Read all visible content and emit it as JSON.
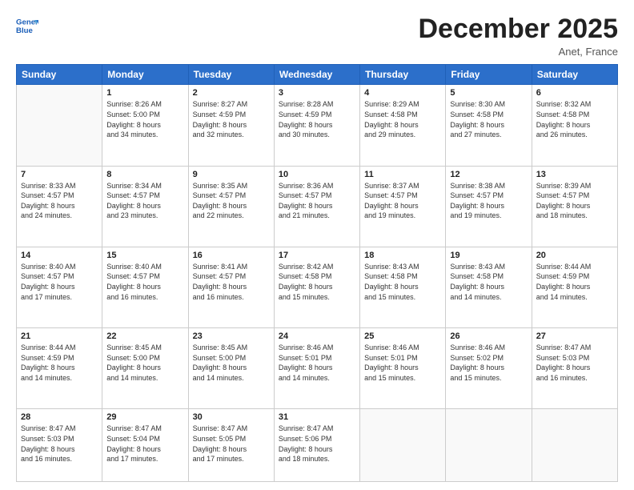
{
  "header": {
    "logo_line1": "General",
    "logo_line2": "Blue",
    "title": "December 2025",
    "location": "Anet, France"
  },
  "weekdays": [
    "Sunday",
    "Monday",
    "Tuesday",
    "Wednesday",
    "Thursday",
    "Friday",
    "Saturday"
  ],
  "weeks": [
    [
      {
        "day": "",
        "info": ""
      },
      {
        "day": "1",
        "info": "Sunrise: 8:26 AM\nSunset: 5:00 PM\nDaylight: 8 hours\nand 34 minutes."
      },
      {
        "day": "2",
        "info": "Sunrise: 8:27 AM\nSunset: 4:59 PM\nDaylight: 8 hours\nand 32 minutes."
      },
      {
        "day": "3",
        "info": "Sunrise: 8:28 AM\nSunset: 4:59 PM\nDaylight: 8 hours\nand 30 minutes."
      },
      {
        "day": "4",
        "info": "Sunrise: 8:29 AM\nSunset: 4:58 PM\nDaylight: 8 hours\nand 29 minutes."
      },
      {
        "day": "5",
        "info": "Sunrise: 8:30 AM\nSunset: 4:58 PM\nDaylight: 8 hours\nand 27 minutes."
      },
      {
        "day": "6",
        "info": "Sunrise: 8:32 AM\nSunset: 4:58 PM\nDaylight: 8 hours\nand 26 minutes."
      }
    ],
    [
      {
        "day": "7",
        "info": "Sunrise: 8:33 AM\nSunset: 4:57 PM\nDaylight: 8 hours\nand 24 minutes."
      },
      {
        "day": "8",
        "info": "Sunrise: 8:34 AM\nSunset: 4:57 PM\nDaylight: 8 hours\nand 23 minutes."
      },
      {
        "day": "9",
        "info": "Sunrise: 8:35 AM\nSunset: 4:57 PM\nDaylight: 8 hours\nand 22 minutes."
      },
      {
        "day": "10",
        "info": "Sunrise: 8:36 AM\nSunset: 4:57 PM\nDaylight: 8 hours\nand 21 minutes."
      },
      {
        "day": "11",
        "info": "Sunrise: 8:37 AM\nSunset: 4:57 PM\nDaylight: 8 hours\nand 19 minutes."
      },
      {
        "day": "12",
        "info": "Sunrise: 8:38 AM\nSunset: 4:57 PM\nDaylight: 8 hours\nand 19 minutes."
      },
      {
        "day": "13",
        "info": "Sunrise: 8:39 AM\nSunset: 4:57 PM\nDaylight: 8 hours\nand 18 minutes."
      }
    ],
    [
      {
        "day": "14",
        "info": "Sunrise: 8:40 AM\nSunset: 4:57 PM\nDaylight: 8 hours\nand 17 minutes."
      },
      {
        "day": "15",
        "info": "Sunrise: 8:40 AM\nSunset: 4:57 PM\nDaylight: 8 hours\nand 16 minutes."
      },
      {
        "day": "16",
        "info": "Sunrise: 8:41 AM\nSunset: 4:57 PM\nDaylight: 8 hours\nand 16 minutes."
      },
      {
        "day": "17",
        "info": "Sunrise: 8:42 AM\nSunset: 4:58 PM\nDaylight: 8 hours\nand 15 minutes."
      },
      {
        "day": "18",
        "info": "Sunrise: 8:43 AM\nSunset: 4:58 PM\nDaylight: 8 hours\nand 15 minutes."
      },
      {
        "day": "19",
        "info": "Sunrise: 8:43 AM\nSunset: 4:58 PM\nDaylight: 8 hours\nand 14 minutes."
      },
      {
        "day": "20",
        "info": "Sunrise: 8:44 AM\nSunset: 4:59 PM\nDaylight: 8 hours\nand 14 minutes."
      }
    ],
    [
      {
        "day": "21",
        "info": "Sunrise: 8:44 AM\nSunset: 4:59 PM\nDaylight: 8 hours\nand 14 minutes."
      },
      {
        "day": "22",
        "info": "Sunrise: 8:45 AM\nSunset: 5:00 PM\nDaylight: 8 hours\nand 14 minutes."
      },
      {
        "day": "23",
        "info": "Sunrise: 8:45 AM\nSunset: 5:00 PM\nDaylight: 8 hours\nand 14 minutes."
      },
      {
        "day": "24",
        "info": "Sunrise: 8:46 AM\nSunset: 5:01 PM\nDaylight: 8 hours\nand 14 minutes."
      },
      {
        "day": "25",
        "info": "Sunrise: 8:46 AM\nSunset: 5:01 PM\nDaylight: 8 hours\nand 15 minutes."
      },
      {
        "day": "26",
        "info": "Sunrise: 8:46 AM\nSunset: 5:02 PM\nDaylight: 8 hours\nand 15 minutes."
      },
      {
        "day": "27",
        "info": "Sunrise: 8:47 AM\nSunset: 5:03 PM\nDaylight: 8 hours\nand 16 minutes."
      }
    ],
    [
      {
        "day": "28",
        "info": "Sunrise: 8:47 AM\nSunset: 5:03 PM\nDaylight: 8 hours\nand 16 minutes."
      },
      {
        "day": "29",
        "info": "Sunrise: 8:47 AM\nSunset: 5:04 PM\nDaylight: 8 hours\nand 17 minutes."
      },
      {
        "day": "30",
        "info": "Sunrise: 8:47 AM\nSunset: 5:05 PM\nDaylight: 8 hours\nand 17 minutes."
      },
      {
        "day": "31",
        "info": "Sunrise: 8:47 AM\nSunset: 5:06 PM\nDaylight: 8 hours\nand 18 minutes."
      },
      {
        "day": "",
        "info": ""
      },
      {
        "day": "",
        "info": ""
      },
      {
        "day": "",
        "info": ""
      }
    ]
  ]
}
